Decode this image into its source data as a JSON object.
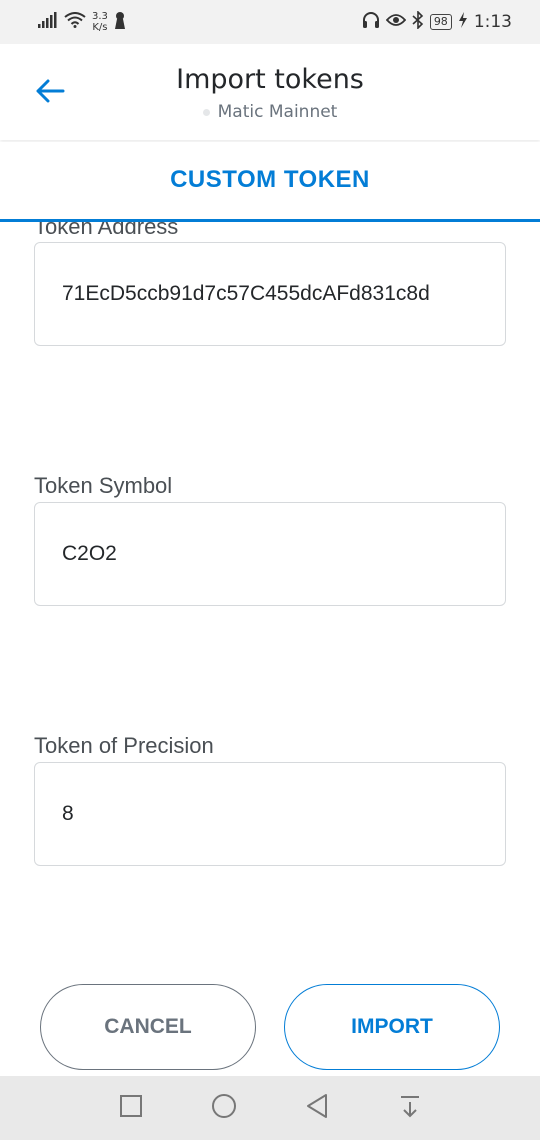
{
  "status_bar": {
    "speed_value": "3.3",
    "speed_unit": "K/s",
    "battery": "98",
    "time": "1:13"
  },
  "header": {
    "title": "Import tokens",
    "network": "Matic Mainnet"
  },
  "tab": {
    "label": "CUSTOM TOKEN"
  },
  "form": {
    "address_label": "Token Address",
    "address_value": "71EcD5ccb91d7c57C455dcAFd831c8d",
    "symbol_label": "Token Symbol",
    "symbol_value": "C2O2",
    "precision_label": "Token of Precision",
    "precision_value": "8"
  },
  "actions": {
    "cancel_label": "CANCEL",
    "import_label": "IMPORT"
  },
  "colors": {
    "accent": "#037dd6",
    "secondary": "#6a737d",
    "border": "#d6d9dc"
  }
}
